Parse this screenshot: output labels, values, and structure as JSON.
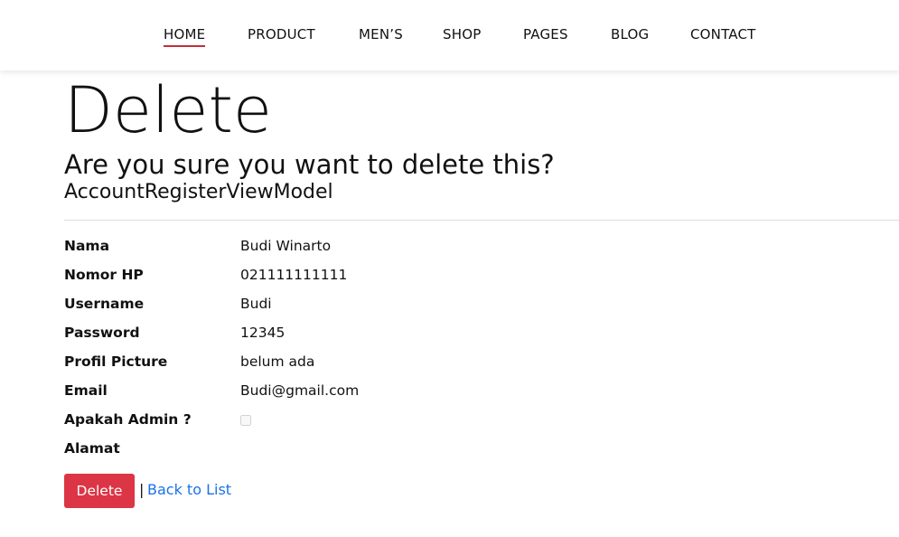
{
  "nav": {
    "items": [
      {
        "label": "HOME",
        "active": true
      },
      {
        "label": "PRODUCT"
      },
      {
        "label": "MEN’S"
      },
      {
        "label": "SHOP"
      },
      {
        "label": "PAGES"
      },
      {
        "label": "BLOG"
      },
      {
        "label": "CONTACT"
      }
    ]
  },
  "page": {
    "title": "Delete",
    "question": "Are you sure you want to delete this?",
    "model_name": "AccountRegisterViewModel"
  },
  "details": [
    {
      "label": "Nama",
      "value": "Budi Winarto"
    },
    {
      "label": "Nomor HP",
      "value": "021111111111"
    },
    {
      "label": "Username",
      "value": "Budi"
    },
    {
      "label": "Password",
      "value": "12345"
    },
    {
      "label": "Profil Picture",
      "value": "belum ada"
    },
    {
      "label": "Email",
      "value": "Budi@gmail.com"
    },
    {
      "label": "Apakah Admin ?",
      "checked": false
    },
    {
      "label": "Alamat",
      "value": ""
    }
  ],
  "actions": {
    "delete_label": "Delete",
    "separator": "|",
    "back_label": "Back to List"
  },
  "colors": {
    "accent_underline": "#c0303a",
    "delete_button": "#dc3545",
    "link": "#1a73e8"
  }
}
